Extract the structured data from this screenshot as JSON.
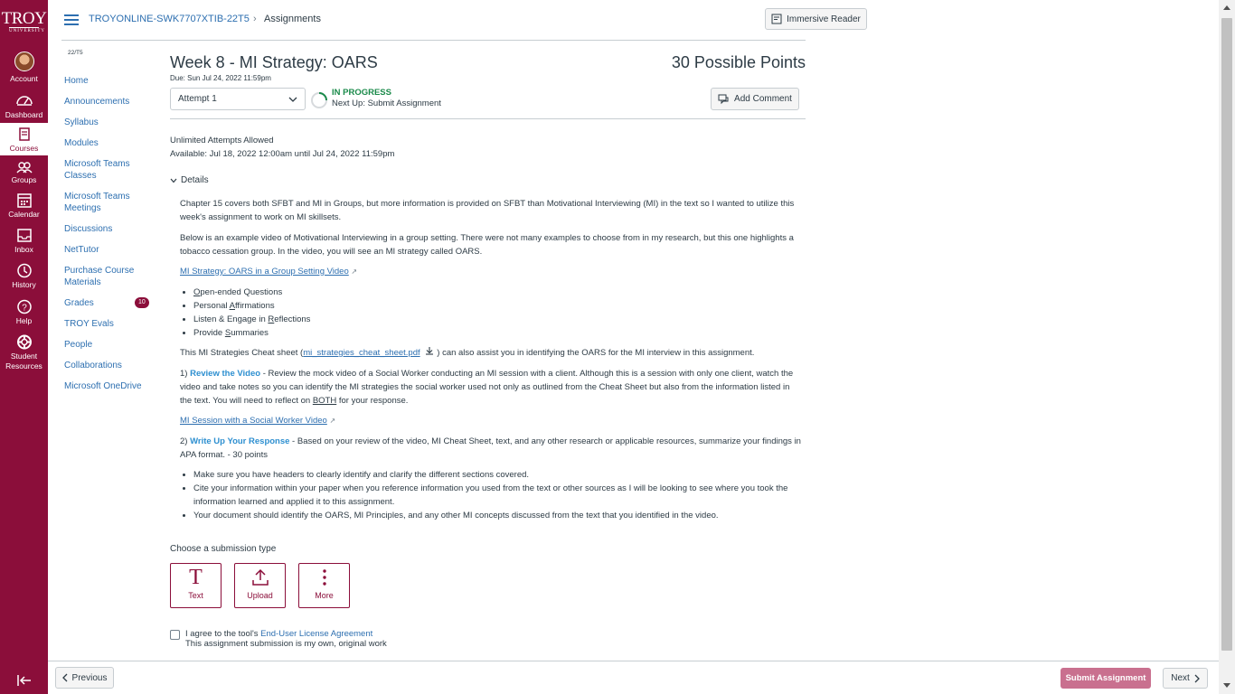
{
  "global_nav": {
    "logo_text": "TROY",
    "logo_sub": "UNIVERSITY",
    "items": [
      {
        "label": "Account"
      },
      {
        "label": "Dashboard"
      },
      {
        "label": "Courses"
      },
      {
        "label": "Groups"
      },
      {
        "label": "Calendar"
      },
      {
        "label": "Inbox"
      },
      {
        "label": "History"
      },
      {
        "label": "Help"
      },
      {
        "label": "Student Resources"
      }
    ]
  },
  "header": {
    "course": "TROYONLINE-SWK7707XTIB-22T5",
    "separator": "›",
    "page": "Assignments",
    "immersive_reader": "Immersive Reader"
  },
  "course_nav": {
    "term": "22/T5",
    "items": [
      {
        "label": "Home"
      },
      {
        "label": "Announcements"
      },
      {
        "label": "Syllabus"
      },
      {
        "label": "Modules"
      },
      {
        "label": "Microsoft Teams Classes"
      },
      {
        "label": "Microsoft Teams Meetings"
      },
      {
        "label": "Discussions"
      },
      {
        "label": "NetTutor"
      },
      {
        "label": "Purchase Course Materials"
      },
      {
        "label": "Grades",
        "badge": "10"
      },
      {
        "label": "TROY Evals"
      },
      {
        "label": "People"
      },
      {
        "label": "Collaborations"
      },
      {
        "label": "Microsoft OneDrive"
      }
    ]
  },
  "assignment": {
    "title": "Week 8 - MI Strategy: OARS",
    "points": "30 Possible Points",
    "due": "Due: Sun Jul 24, 2022 11:59pm",
    "attempt": "Attempt 1",
    "status": "IN PROGRESS",
    "next_up": "Next Up: Submit Assignment",
    "add_comment": "Add Comment",
    "attempts_allowed": "Unlimited Attempts Allowed",
    "available": "Available: Jul 18, 2022 12:00am until Jul 24, 2022 11:59pm",
    "details_label": "Details",
    "p1": "Chapter 15 covers both SFBT and MI in Groups, but more information is provided on SFBT than Motivational Interviewing (MI) in the text so I wanted to utilize this week's assignment to work on MI skillsets.",
    "p2": "Below is an example video of Motivational Interviewing in a group setting. There were not many examples to choose from in my research, but this one highlights a tobacco cessation group. In the video, you will see an MI strategy called OARS.",
    "link1": "MI Strategy: OARS in a Group Setting Video",
    "oars": [
      {
        "first": "O",
        "rest": "pen-ended Questions",
        "pre": ""
      },
      {
        "pre": "Personal ",
        "first": "A",
        "rest": "ffirmations"
      },
      {
        "pre": "Listen & Engage in ",
        "first": "R",
        "rest": "eflections"
      },
      {
        "pre": "Provide ",
        "first": "S",
        "rest": "ummaries"
      }
    ],
    "cheat_pre": "This MI Strategies Cheat sheet (",
    "cheat_file": "mi_strategies_cheat_sheet.pdf",
    "cheat_post": ") can also assist you in identifying the OARS for the MI interview in this assignment.",
    "step1_num": "1) ",
    "step1_title": "Review the Video",
    "step1_text_a": " - Review the mock video of a Social Worker conducting an MI session with a client. Although this is a session with only one client, watch the video and take notes so you can identify the MI strategies the social worker used not only as outlined from the Cheat Sheet but also from the information listed in the text. You will need to reflect on ",
    "step1_both": "BOTH",
    "step1_text_b": " for your response.",
    "link2": "MI Session with a Social Worker Video",
    "step2_num": "2) ",
    "step2_title": "Write Up Your Response",
    "step2_text": " - Based on your review of the video, MI Cheat Sheet, text, and any other research or applicable resources, summarize your findings in APA format. - 30 points",
    "bullets": [
      "Make sure you have headers to clearly identify and clarify the different sections covered.",
      "Cite your information within your paper when you reference information you used from the text or other sources as I will be looking to see where you took the information learned and applied it to this assignment.",
      "Your document should identify the OARS, MI Principles, and any other MI concepts discussed from the text that you identified in the video."
    ],
    "choose_label": "Choose a submission type",
    "sub_types": [
      {
        "label": "Text",
        "icon": "T"
      },
      {
        "label": "Upload",
        "icon": "upload-icon"
      },
      {
        "label": "More",
        "icon": "more-icon"
      }
    ],
    "agree_pre": "I agree to the tool's ",
    "agree_link": "End-User License Agreement",
    "agree_line2": "This assignment submission is my own, original work"
  },
  "footer": {
    "previous": "Previous",
    "submit": "Submit Assignment",
    "next": "Next"
  },
  "colors": {
    "brand": "#8b0e3a",
    "link": "#2d6fb0",
    "status_green": "#1a8a4a"
  }
}
